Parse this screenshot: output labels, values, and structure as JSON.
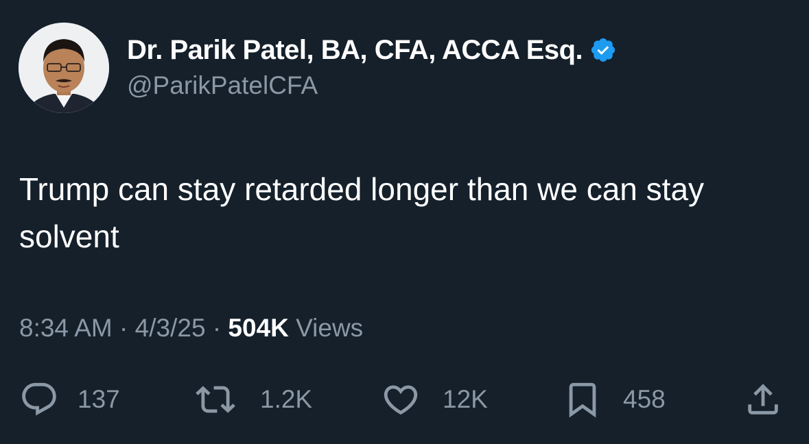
{
  "author": {
    "display_name": "Dr. Parik Patel, BA, CFA, ACCA Esq.",
    "handle": "@ParikPatelCFA",
    "verified_icon": "verified-badge-icon",
    "verified_color": "#1d9bf0"
  },
  "tweet": {
    "text": "Trump can stay retarded longer than we can stay solvent"
  },
  "meta": {
    "time": "8:34 AM",
    "separator": "·",
    "date": "4/3/25",
    "views_count": "504K",
    "views_label": "Views"
  },
  "actions": {
    "replies": {
      "icon": "reply-icon",
      "count": "137"
    },
    "retweets": {
      "icon": "retweet-icon",
      "count": "1.2K"
    },
    "likes": {
      "icon": "heart-icon",
      "count": "12K"
    },
    "bookmarks": {
      "icon": "bookmark-icon",
      "count": "458"
    },
    "share": {
      "icon": "share-icon"
    }
  },
  "colors": {
    "background": "#15202b",
    "text_primary": "#ffffff",
    "text_secondary": "#8b98a5"
  }
}
